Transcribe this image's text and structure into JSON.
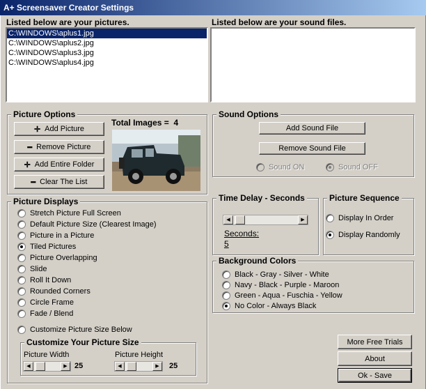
{
  "window": {
    "title": "A+ Screensaver Creator Settings"
  },
  "pictures": {
    "header": "Listed below are your pictures.",
    "files": [
      "C:\\WINDOWS\\aplus1.jpg",
      "C:\\WINDOWS\\aplus2.jpg",
      "C:\\WINDOWS\\aplus3.jpg",
      "C:\\WINDOWS\\aplus4.jpg"
    ],
    "selected_index": 0
  },
  "sounds": {
    "header": "Listed below are your sound files.",
    "files": []
  },
  "picture_options": {
    "title": "Picture Options",
    "total_label": "Total Images =",
    "total_value": "4",
    "buttons": {
      "add": "Add Picture",
      "remove": "Remove Picture",
      "add_folder": "Add Entire Folder",
      "clear": "Clear The List"
    },
    "icons": {
      "add": "plus-icon",
      "remove": "minus-icon",
      "add_folder": "plus-icon",
      "clear": "minus-icon"
    }
  },
  "sound_options": {
    "title": "Sound Options",
    "add_button": "Add Sound File",
    "remove_button": "Remove Sound File",
    "sound_on": "Sound ON",
    "sound_off": "Sound OFF",
    "selected": "off",
    "disabled": true
  },
  "picture_displays": {
    "title": "Picture Displays",
    "options": [
      "Stretch Picture Full Screen",
      "Default Picture Size (Clearest Image)",
      "Picture in a Picture",
      "Tiled Pictures",
      "Picture Overlapping",
      "Slide",
      "Roll It Down",
      "Rounded Corners",
      "Circle Frame",
      "Fade / Blend"
    ],
    "selected_index": 3,
    "customize_option": "Customize Picture Size Below",
    "customize": {
      "title": "Customize Your Picture Size",
      "width_label": "Picture Width",
      "width_value": "25",
      "height_label": "Picture Height",
      "height_value": "25"
    }
  },
  "time_delay": {
    "title": "Time Delay - Seconds",
    "seconds_label": "Seconds:",
    "seconds_value": "5"
  },
  "picture_sequence": {
    "title": "Picture Sequence",
    "options": [
      "Display In Order",
      "Display Randomly"
    ],
    "selected_index": 1
  },
  "background_colors": {
    "title": "Background Colors",
    "options": [
      "Black - Gray - Silver - White",
      "Navy - Black - Purple - Maroon",
      "Green - Aqua - Fuschia - Yellow",
      "No Color - Always Black"
    ],
    "selected_index": 3
  },
  "actions": {
    "more_trials": "More Free Trials",
    "about": "About",
    "ok_save": "Ok - Save"
  },
  "colors": {
    "title_start": "#0a246a",
    "title_end": "#a6caf0",
    "face": "#d4d0c8",
    "selection": "#0a246a"
  }
}
